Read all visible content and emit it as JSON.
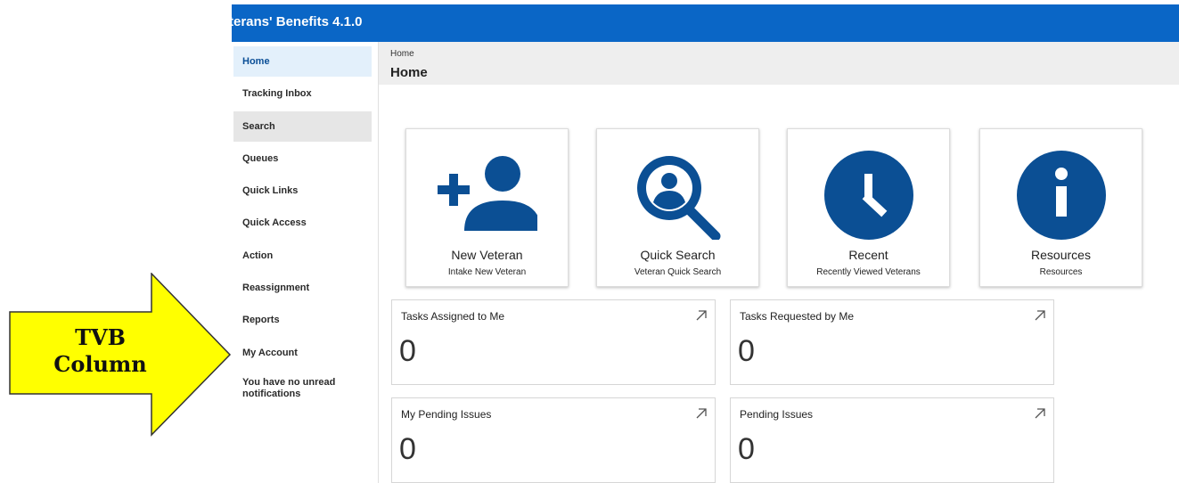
{
  "app": {
    "title": "terans' Benefits 4.1.0"
  },
  "sidebar": {
    "items": [
      {
        "label": "Home",
        "state": "active"
      },
      {
        "label": "Tracking Inbox",
        "state": "normal"
      },
      {
        "label": "Search",
        "state": "hover"
      },
      {
        "label": "Queues",
        "state": "normal"
      },
      {
        "label": "Quick Links",
        "state": "normal"
      },
      {
        "label": "Quick Access",
        "state": "normal"
      },
      {
        "label": "Action",
        "state": "normal"
      },
      {
        "label": "Reassignment",
        "state": "normal"
      },
      {
        "label": "Reports",
        "state": "normal"
      },
      {
        "label": "My Account",
        "state": "normal"
      }
    ],
    "notification": "You have no unread notifications"
  },
  "breadcrumb": "Home",
  "page_title": "Home",
  "tiles": [
    {
      "title": "New Veteran",
      "subtitle": "Intake New Veteran",
      "icon": "add-user-icon"
    },
    {
      "title": "Quick Search",
      "subtitle": "Veteran Quick Search",
      "icon": "person-search-icon"
    },
    {
      "title": "Recent",
      "subtitle": "Recently Viewed Veterans",
      "icon": "clock-icon"
    },
    {
      "title": "Resources",
      "subtitle": "Resources",
      "icon": "info-icon"
    }
  ],
  "cards": [
    {
      "title": "Tasks Assigned to Me",
      "count": "0"
    },
    {
      "title": "Tasks Requested by Me",
      "count": "0"
    },
    {
      "title": "My Pending Issues",
      "count": "0"
    },
    {
      "title": "Pending Issues",
      "count": "0"
    }
  ],
  "callout": {
    "line1": "TVB",
    "line2": "Column"
  },
  "colors": {
    "brand": "#0a66c6",
    "icon": "#0b4f94",
    "callout": "#ffff00"
  }
}
